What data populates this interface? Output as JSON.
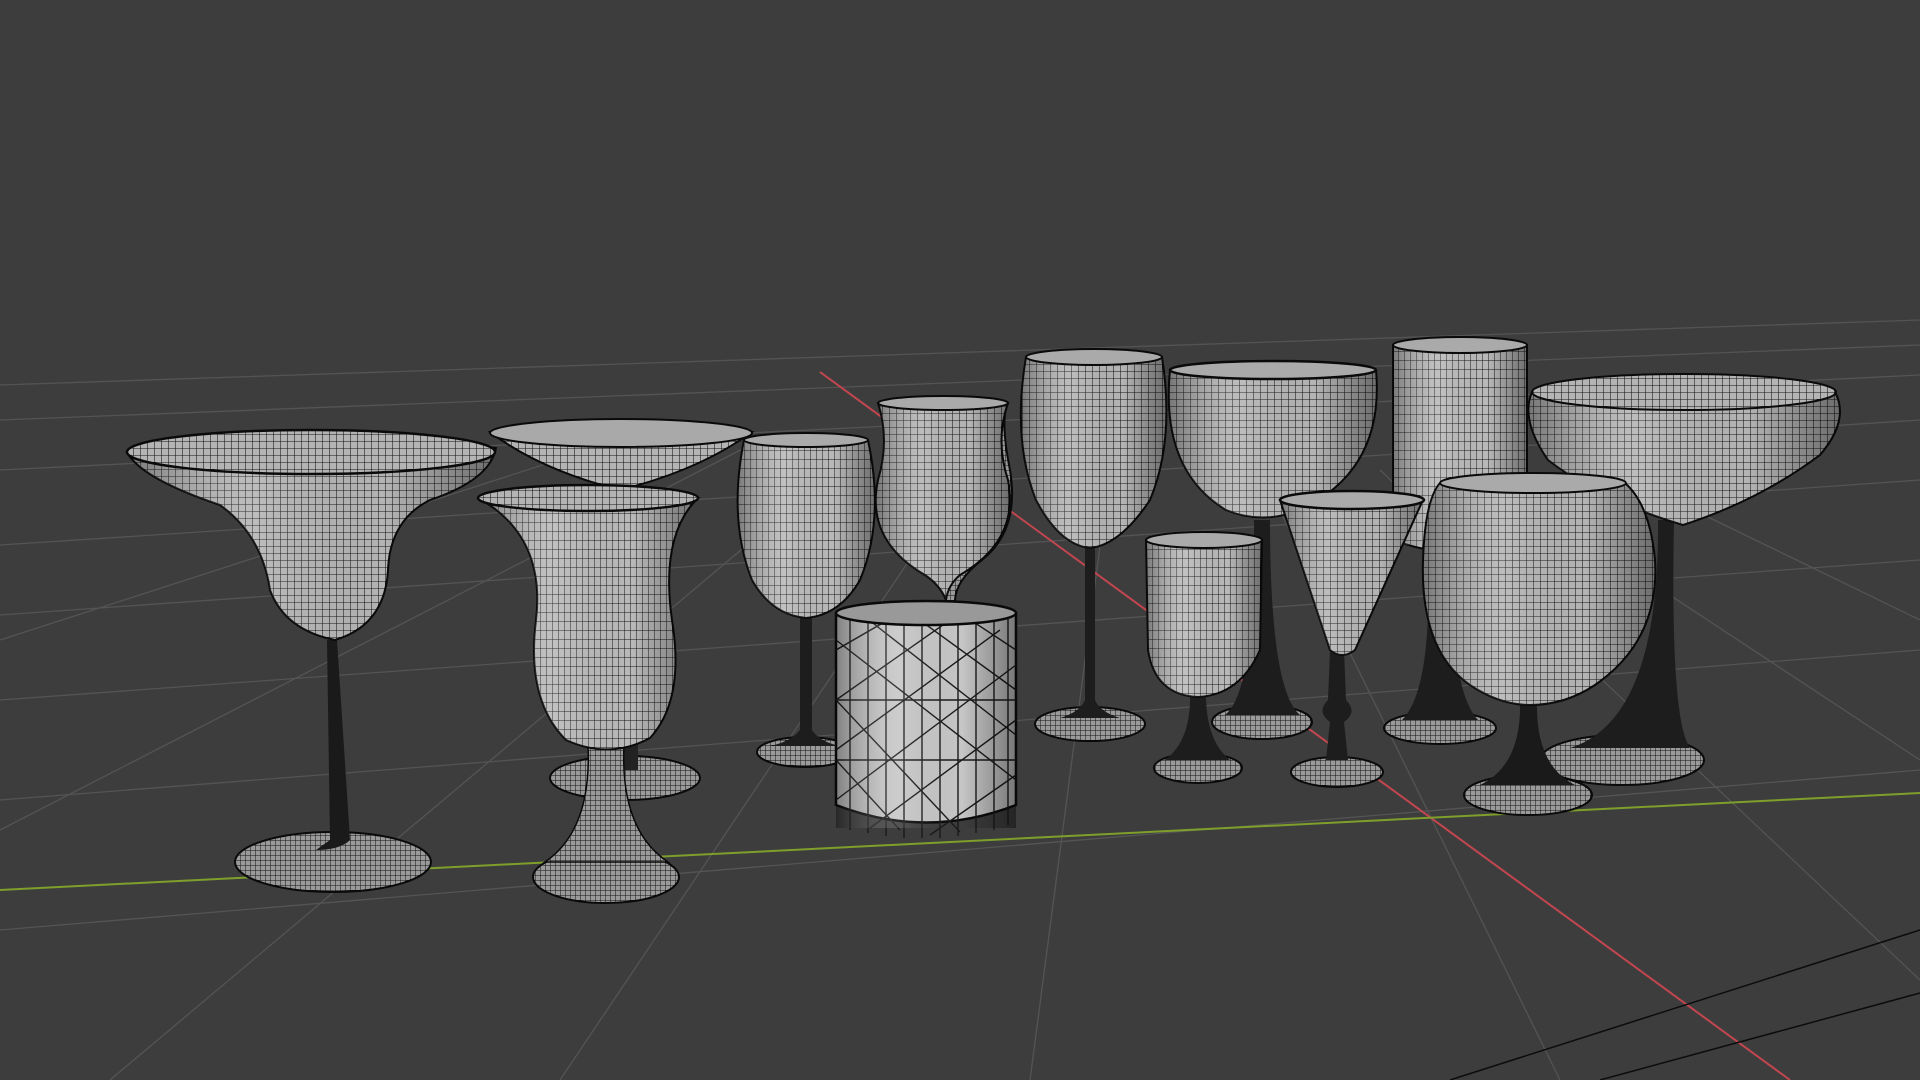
{
  "viewport": {
    "background": "#3d3d3d",
    "grid_color": "#545454",
    "axis_x_color": "#c2464f",
    "axis_y_color": "#7e9f2b",
    "mesh_fill_light": "#c9c9c9",
    "mesh_fill_dark": "#8c8c8c",
    "wire_color": "#101010",
    "shading_mode": "wireframe-overlay"
  },
  "objects": [
    {
      "name": "margarita-glass"
    },
    {
      "name": "coupe-glass-back"
    },
    {
      "name": "hurricane-glass"
    },
    {
      "name": "wine-glass-small"
    },
    {
      "name": "tulip-glass"
    },
    {
      "name": "rocks-glass-cut"
    },
    {
      "name": "wine-glass-tall"
    },
    {
      "name": "cordial-glass"
    },
    {
      "name": "goblet-wide"
    },
    {
      "name": "cone-cordial-glass"
    },
    {
      "name": "highball-glass"
    },
    {
      "name": "brandy-snifter"
    },
    {
      "name": "champagne-coupe"
    }
  ]
}
